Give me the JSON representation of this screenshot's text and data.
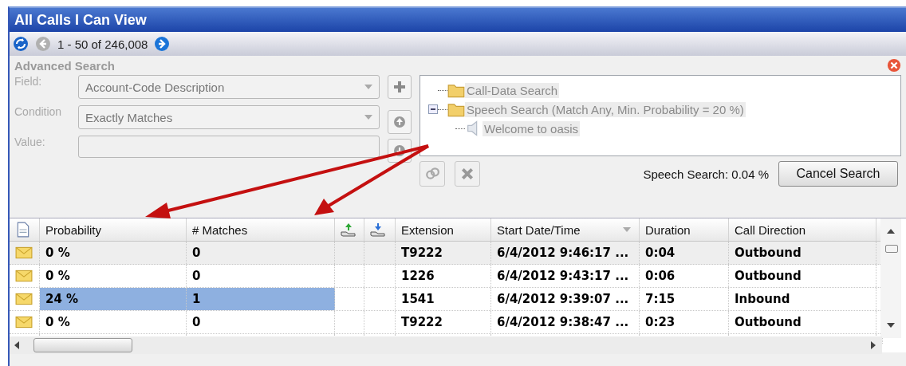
{
  "window": {
    "title": "All Calls I Can View"
  },
  "pager": {
    "range": "1 - 50 of 246,008",
    "prev_disabled": true
  },
  "advanced_search": {
    "title": "Advanced Search",
    "fields": [
      {
        "label": "Field:",
        "kind": "dropdown",
        "value": "Account-Code Description"
      },
      {
        "label": "Condition",
        "kind": "dropdown",
        "value": "Exactly Matches"
      },
      {
        "label": "Value:",
        "kind": "text"
      }
    ],
    "tree": [
      {
        "label": "Call-Data Search",
        "kind": "folder"
      },
      {
        "label": "Speech Search (Match Any, Min. Probability = 20 %)",
        "kind": "folder",
        "expanded": true,
        "children": [
          {
            "label": "Welcome to oasis",
            "kind": "phrase"
          }
        ]
      }
    ],
    "progress": "Speech Search: 0.04 %",
    "cancel_button": "Cancel Search"
  },
  "table": {
    "columns": [
      {
        "kind": "doc",
        "dropdown": false
      },
      {
        "kind": "text",
        "label": "Probability",
        "dropdown": false
      },
      {
        "kind": "text",
        "label": "# Matches",
        "dropdown": false
      },
      {
        "kind": "upload",
        "dropdown": false
      },
      {
        "kind": "download",
        "dropdown": false
      },
      {
        "kind": "text",
        "label": "Extension",
        "dropdown": false
      },
      {
        "kind": "text",
        "label": "Start Date/Time",
        "dropdown": true
      },
      {
        "kind": "text",
        "label": "Duration",
        "dropdown": false
      },
      {
        "kind": "text",
        "label": "Call Direction",
        "dropdown": false
      }
    ],
    "rows": [
      {
        "selected": true,
        "match_highlight": false,
        "probability": "0 %",
        "matches": "0",
        "extension": "T9222",
        "start": "6/4/2012 9:46:17 ...",
        "duration": "0:04",
        "direction": "Outbound"
      },
      {
        "selected": false,
        "match_highlight": false,
        "probability": "0 %",
        "matches": "0",
        "extension": "1226",
        "start": "6/4/2012 9:43:17 ...",
        "duration": "0:06",
        "direction": "Outbound"
      },
      {
        "selected": false,
        "match_highlight": true,
        "probability": "24 %",
        "matches": "1",
        "extension": "1541",
        "start": "6/4/2012 9:39:07 ...",
        "duration": "7:15",
        "direction": "Inbound"
      },
      {
        "selected": false,
        "match_highlight": false,
        "probability": "0 %",
        "matches": "0",
        "extension": "T9222",
        "start": "6/4/2012 9:38:47 ...",
        "duration": "0:23",
        "direction": "Outbound"
      }
    ]
  }
}
